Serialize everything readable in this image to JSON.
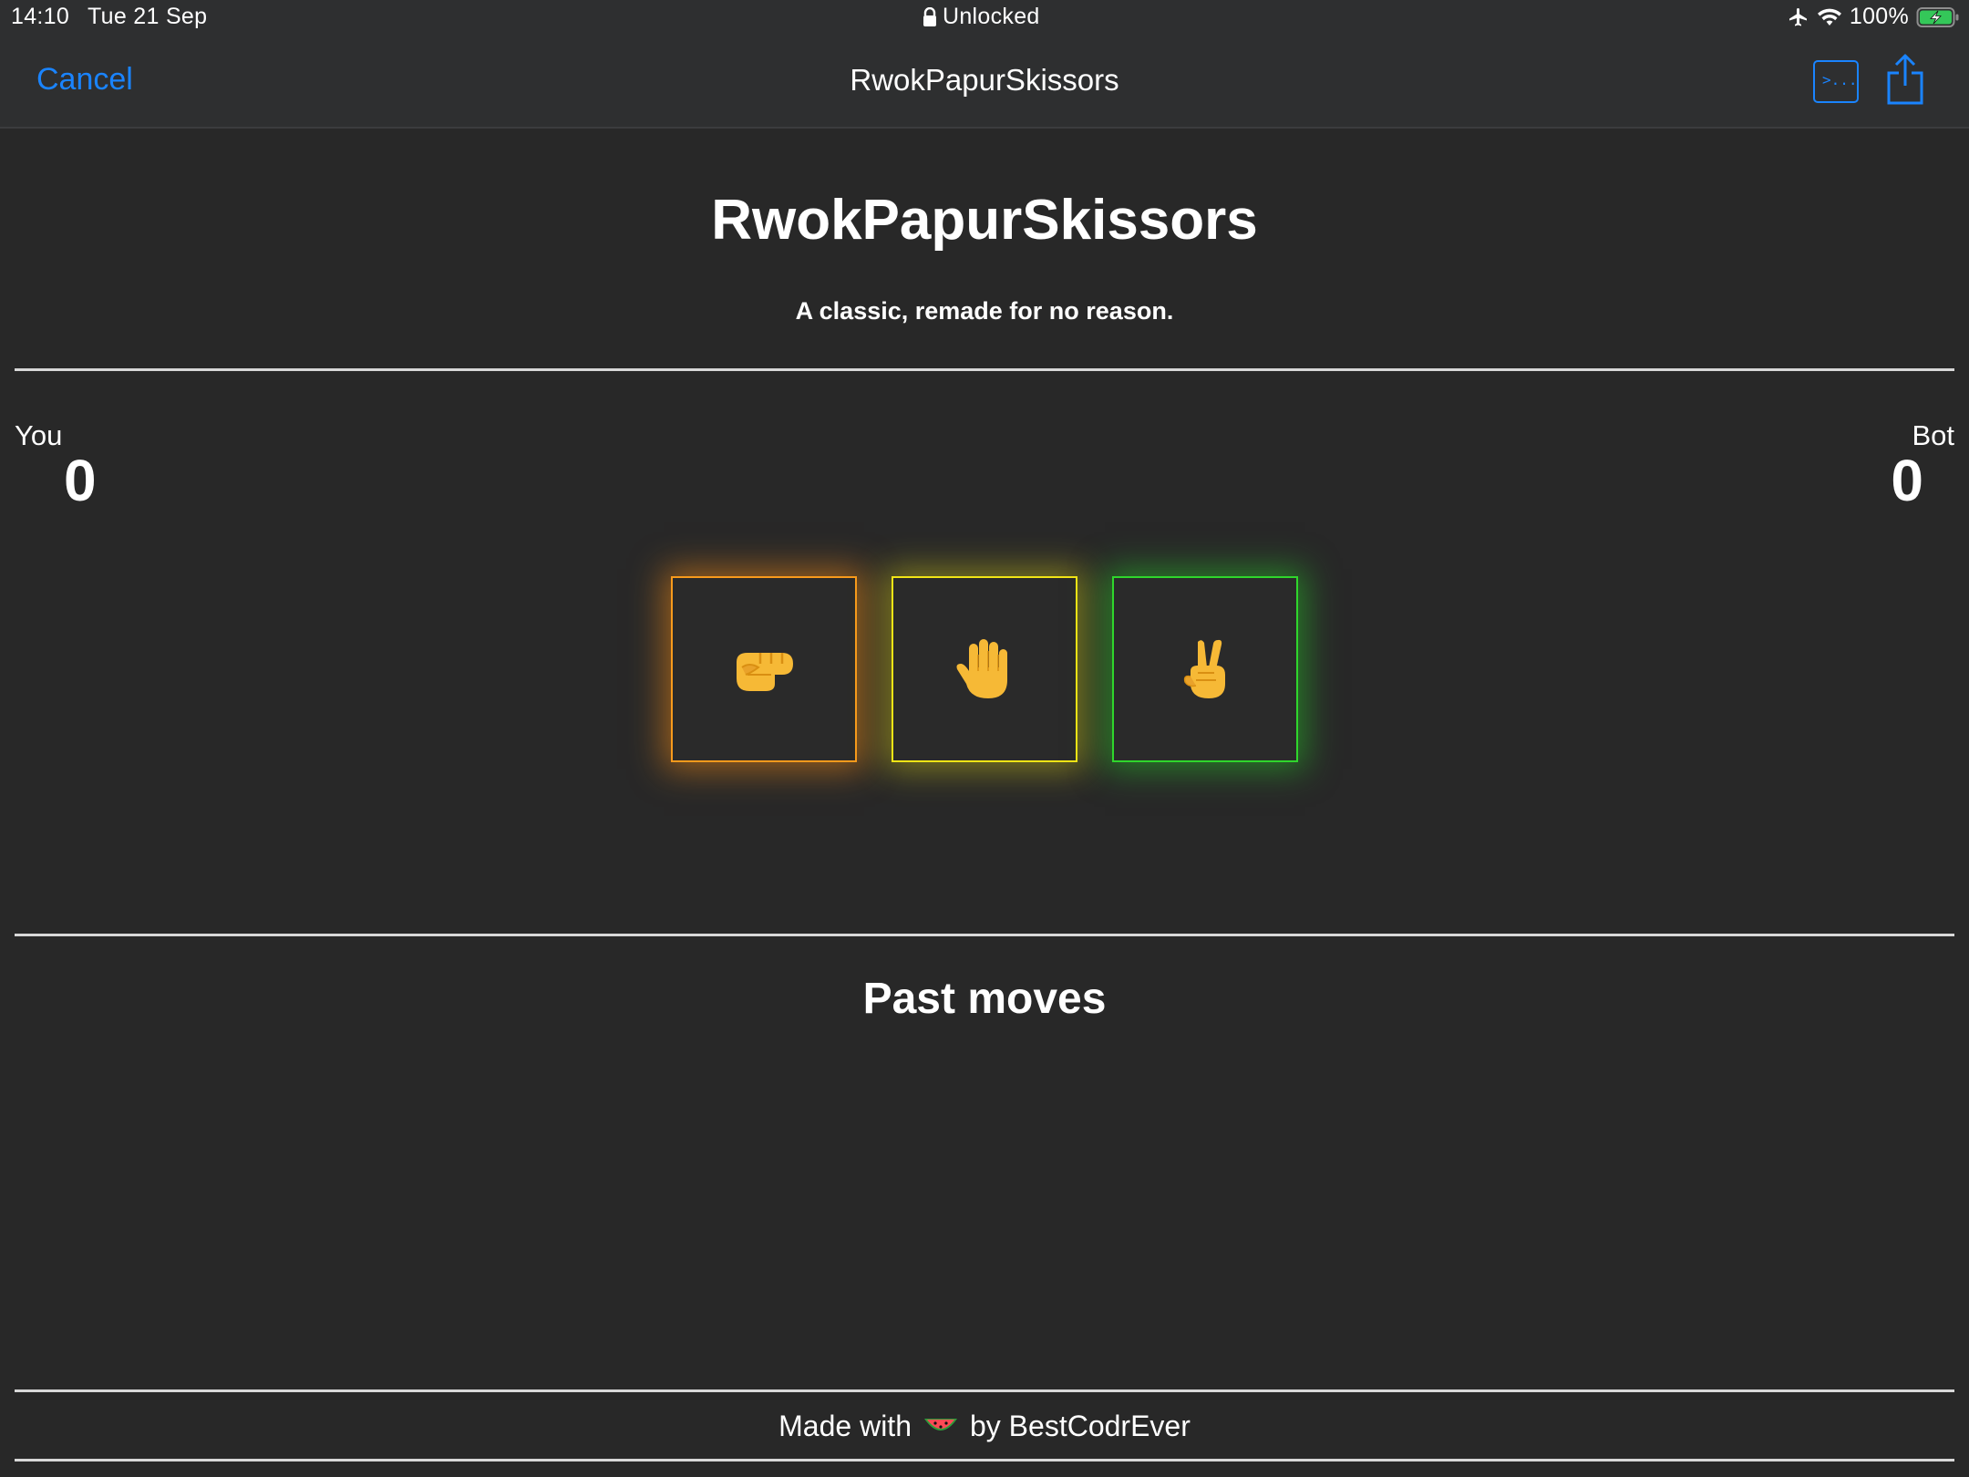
{
  "status_bar": {
    "time": "14:10",
    "date": "Tue 21 Sep",
    "lock_text": "Unlocked",
    "battery": "100%",
    "icons": [
      "lock-icon",
      "airplane-icon",
      "wifi-icon",
      "battery-charging-icon"
    ]
  },
  "nav": {
    "cancel_label": "Cancel",
    "title": "RwokPapurSkissors",
    "terminal_icon_text": ">...",
    "accent_color": "#1a84ff"
  },
  "header": {
    "title": "RwokPapurSkissors",
    "subtitle": "A classic, remade for no reason."
  },
  "scores": {
    "player_label": "You",
    "player_score": "0",
    "bot_label": "Bot",
    "bot_score": "0"
  },
  "moves": [
    {
      "name": "rock",
      "icon": "fist-icon",
      "color": "#f79a1c"
    },
    {
      "name": "paper",
      "icon": "raised-hand-icon",
      "color": "#f2e516"
    },
    {
      "name": "scissors",
      "icon": "victory-hand-icon",
      "color": "#2fd62c"
    }
  ],
  "past_moves": {
    "title": "Past moves",
    "items": []
  },
  "footer": {
    "prefix": "Made with",
    "icon": "watermelon-icon",
    "suffix": "by BestCodrEver"
  }
}
